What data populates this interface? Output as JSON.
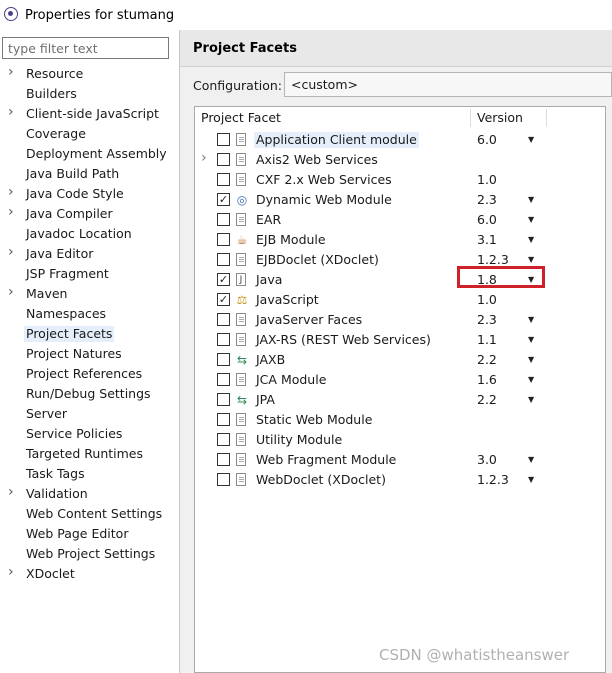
{
  "window": {
    "title": "Properties for stumang"
  },
  "filter": {
    "placeholder": "type filter text"
  },
  "tree": [
    {
      "label": "Resource",
      "expandable": true
    },
    {
      "label": "Builders",
      "expandable": false
    },
    {
      "label": "Client-side JavaScript",
      "expandable": true
    },
    {
      "label": "Coverage",
      "expandable": false
    },
    {
      "label": "Deployment Assembly",
      "expandable": false
    },
    {
      "label": "Java Build Path",
      "expandable": false
    },
    {
      "label": "Java Code Style",
      "expandable": true
    },
    {
      "label": "Java Compiler",
      "expandable": true
    },
    {
      "label": "Javadoc Location",
      "expandable": false
    },
    {
      "label": "Java Editor",
      "expandable": true
    },
    {
      "label": "JSP Fragment",
      "expandable": false
    },
    {
      "label": "Maven",
      "expandable": true
    },
    {
      "label": "Namespaces",
      "expandable": false
    },
    {
      "label": "Project Facets",
      "expandable": false,
      "selected": true
    },
    {
      "label": "Project Natures",
      "expandable": false
    },
    {
      "label": "Project References",
      "expandable": false
    },
    {
      "label": "Run/Debug Settings",
      "expandable": false
    },
    {
      "label": "Server",
      "expandable": false
    },
    {
      "label": "Service Policies",
      "expandable": false
    },
    {
      "label": "Targeted Runtimes",
      "expandable": false
    },
    {
      "label": "Task Tags",
      "expandable": false
    },
    {
      "label": "Validation",
      "expandable": true
    },
    {
      "label": "Web Content Settings",
      "expandable": false
    },
    {
      "label": "Web Page Editor",
      "expandable": false
    },
    {
      "label": "Web Project Settings",
      "expandable": false
    },
    {
      "label": "XDoclet",
      "expandable": true
    }
  ],
  "page": {
    "title": "Project Facets",
    "configuration_label": "Configuration:",
    "configuration_value": "<custom>"
  },
  "table": {
    "col_facet": "Project Facet",
    "col_version": "Version",
    "rows": [
      {
        "name": "Application Client module",
        "version": "6.0",
        "checked": false,
        "dropdown": true,
        "icon": "document-icon",
        "highlight": true
      },
      {
        "name": "Axis2 Web Services",
        "version": "",
        "checked": false,
        "dropdown": false,
        "icon": "document-icon",
        "expandable": true
      },
      {
        "name": "CXF 2.x Web Services",
        "version": "1.0",
        "checked": false,
        "dropdown": false,
        "icon": "document-icon"
      },
      {
        "name": "Dynamic Web Module",
        "version": "2.3",
        "checked": true,
        "dropdown": true,
        "icon": "globe-icon"
      },
      {
        "name": "EAR",
        "version": "6.0",
        "checked": false,
        "dropdown": true,
        "icon": "document-icon"
      },
      {
        "name": "EJB Module",
        "version": "3.1",
        "checked": false,
        "dropdown": true,
        "icon": "bean-icon"
      },
      {
        "name": "EJBDoclet (XDoclet)",
        "version": "1.2.3",
        "checked": false,
        "dropdown": true,
        "icon": "document-icon"
      },
      {
        "name": "Java",
        "version": "1.8",
        "checked": true,
        "dropdown": true,
        "icon": "java-icon"
      },
      {
        "name": "JavaScript",
        "version": "1.0",
        "checked": true,
        "dropdown": false,
        "icon": "lock-icon"
      },
      {
        "name": "JavaServer Faces",
        "version": "2.3",
        "checked": false,
        "dropdown": true,
        "icon": "document-icon"
      },
      {
        "name": "JAX-RS (REST Web Services)",
        "version": "1.1",
        "checked": false,
        "dropdown": true,
        "icon": "document-icon"
      },
      {
        "name": "JAXB",
        "version": "2.2",
        "checked": false,
        "dropdown": true,
        "icon": "arrows-icon"
      },
      {
        "name": "JCA Module",
        "version": "1.6",
        "checked": false,
        "dropdown": true,
        "icon": "document-icon"
      },
      {
        "name": "JPA",
        "version": "2.2",
        "checked": false,
        "dropdown": true,
        "icon": "arrows-icon"
      },
      {
        "name": "Static Web Module",
        "version": "",
        "checked": false,
        "dropdown": false,
        "icon": "document-icon"
      },
      {
        "name": "Utility Module",
        "version": "",
        "checked": false,
        "dropdown": false,
        "icon": "document-icon"
      },
      {
        "name": "Web Fragment Module",
        "version": "3.0",
        "checked": false,
        "dropdown": true,
        "icon": "document-icon"
      },
      {
        "name": "WebDoclet (XDoclet)",
        "version": "1.2.3",
        "checked": false,
        "dropdown": true,
        "icon": "document-icon"
      }
    ]
  },
  "watermark": "CSDN @whatistheanswer"
}
